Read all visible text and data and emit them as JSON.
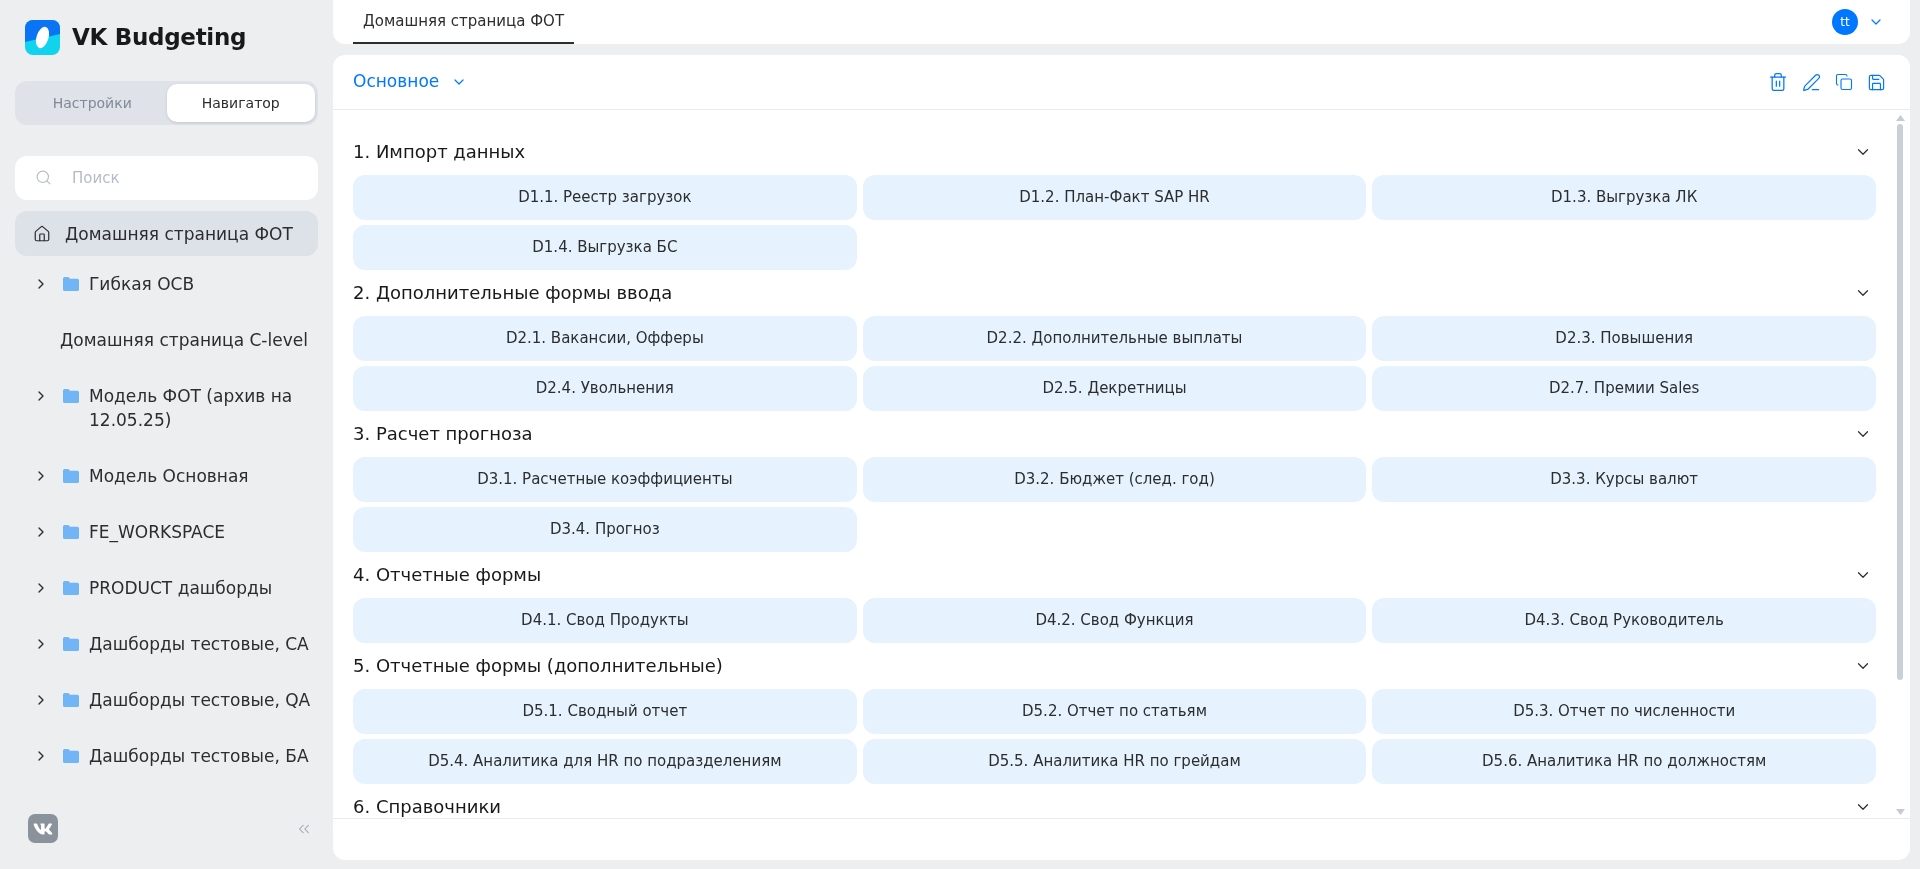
{
  "app": {
    "title": "VK Budgeting"
  },
  "sidebar": {
    "tabs": [
      {
        "label": "Настройки",
        "selected": false
      },
      {
        "label": "Навигатор",
        "selected": true
      }
    ],
    "search": {
      "placeholder": "Поиск"
    },
    "items": [
      {
        "kind": "home",
        "label": "Домашняя страница ФОТ",
        "selected": true
      },
      {
        "kind": "folder",
        "label": "Гибкая ОСВ",
        "selected": false,
        "expanded": false
      },
      {
        "kind": "page",
        "label": "Домашняя страница C-level",
        "selected": false
      },
      {
        "kind": "folder",
        "label": "Модель ФОТ (архив на 12.05.25)",
        "selected": false,
        "expanded": false
      },
      {
        "kind": "folder",
        "label": "Модель Основная",
        "selected": false,
        "expanded": false
      },
      {
        "kind": "folder",
        "label": "FE_WORKSPACE",
        "selected": false,
        "expanded": false
      },
      {
        "kind": "folder",
        "label": "PRODUCT дашборды",
        "selected": false,
        "expanded": false
      },
      {
        "kind": "folder",
        "label": "Дашборды тестовые, СА",
        "selected": false,
        "expanded": false
      },
      {
        "kind": "folder",
        "label": "Дашборды тестовые, QA",
        "selected": false,
        "expanded": false
      },
      {
        "kind": "folder",
        "label": "Дашборды тестовые, БА",
        "selected": false,
        "expanded": false
      }
    ]
  },
  "topbar": {
    "tabs": [
      {
        "label": "Домашняя страница ФОТ",
        "selected": true
      }
    ],
    "user": {
      "initials": "tt"
    }
  },
  "panel": {
    "view": {
      "label": "Основное"
    },
    "sections": [
      {
        "title": "1. Импорт данных",
        "buttons": [
          "D1.1. Реестр загрузок",
          "D1.2. План-Факт SAP HR",
          "D1.3. Выгрузка ЛК",
          "D1.4. Выгрузка БС"
        ]
      },
      {
        "title": "2. Дополнительные формы ввода",
        "buttons": [
          "D2.1. Вакансии, Офферы",
          "D2.2. Дополнительные выплаты",
          "D2.3. Повышения",
          "D2.4. Увольнения",
          "D2.5. Декретницы",
          "D2.7. Премии Sales"
        ]
      },
      {
        "title": "3. Расчет прогноза",
        "buttons": [
          "D3.1. Расчетные коэффициенты",
          "D3.2. Бюджет (след. год)",
          "D3.3. Курсы валют",
          "D3.4. Прогноз"
        ]
      },
      {
        "title": "4. Отчетные формы",
        "buttons": [
          "D4.1. Свод Продукты",
          "D4.2. Свод Функция",
          "D4.3. Свод Руководитель"
        ]
      },
      {
        "title": "5. Отчетные формы (дополнительные)",
        "buttons": [
          "D5.1. Сводный отчет",
          "D5.2. Отчет по статьям",
          "D5.3. Отчет по численности",
          "D5.4. Аналитика для HR по подразделениям",
          "D5.5. Аналитика HR по грейдам",
          "D5.6. Аналитика HR по должностям"
        ]
      },
      {
        "title": "6. Справочники"
      }
    ]
  }
}
